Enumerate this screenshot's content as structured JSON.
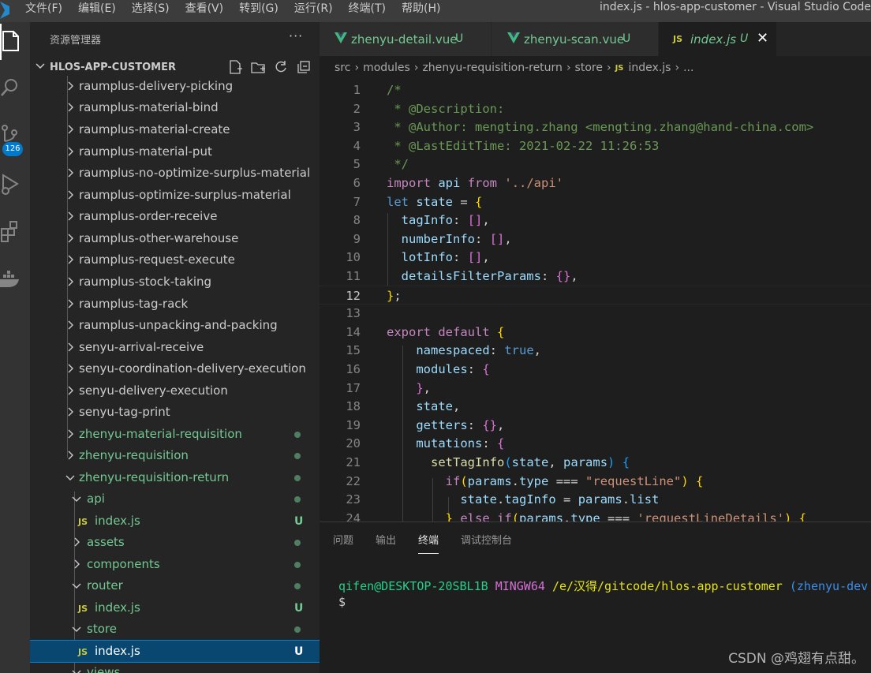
{
  "menu": [
    "文件(F)",
    "编辑(E)",
    "选择(S)",
    "查看(V)",
    "转到(G)",
    "运行(R)",
    "终端(T)",
    "帮助(H)"
  ],
  "window_title": "index.js - hlos-app-customer - Visual Studio Code",
  "activity": {
    "scm_badge": "126",
    "icons": [
      "explorer-icon",
      "search-icon",
      "source-control-icon",
      "run-debug-icon",
      "extensions-icon",
      "docker-icon"
    ]
  },
  "sidebar": {
    "title": "资源管理器",
    "more": "···",
    "project": "HLOS-APP-CUSTOMER",
    "items": [
      {
        "label": "raumplus-delivery-picking",
        "status": ""
      },
      {
        "label": "raumplus-material-bind",
        "status": ""
      },
      {
        "label": "raumplus-material-create",
        "status": ""
      },
      {
        "label": "raumplus-material-put",
        "status": ""
      },
      {
        "label": "raumplus-no-optimize-surplus-material",
        "status": ""
      },
      {
        "label": "raumplus-optimize-surplus-material",
        "status": ""
      },
      {
        "label": "raumplus-order-receive",
        "status": ""
      },
      {
        "label": "raumplus-other-warehouse",
        "status": ""
      },
      {
        "label": "raumplus-request-execute",
        "status": ""
      },
      {
        "label": "raumplus-stock-taking",
        "status": ""
      },
      {
        "label": "raumplus-tag-rack",
        "status": ""
      },
      {
        "label": "raumplus-unpacking-and-packing",
        "status": ""
      },
      {
        "label": "senyu-arrival-receive",
        "status": ""
      },
      {
        "label": "senyu-coordination-delivery-execution",
        "status": ""
      },
      {
        "label": "senyu-delivery-execution",
        "status": ""
      },
      {
        "label": "senyu-tag-print",
        "status": ""
      },
      {
        "label": "zhenyu-material-requisition",
        "status": ""
      },
      {
        "label": "zhenyu-requisition",
        "status": ""
      },
      {
        "label": "zhenyu-requisition-return",
        "status": ""
      },
      {
        "label": "api",
        "status": ""
      },
      {
        "label": "index.js",
        "status": "U"
      },
      {
        "label": "assets",
        "status": ""
      },
      {
        "label": "components",
        "status": ""
      },
      {
        "label": "router",
        "status": ""
      },
      {
        "label": "index.js",
        "status": "U"
      },
      {
        "label": "store",
        "status": ""
      },
      {
        "label": "index.js",
        "status": "U"
      },
      {
        "label": "views",
        "status": ""
      }
    ]
  },
  "tabs": [
    {
      "name": "zhenyu-detail.vue",
      "status": "U"
    },
    {
      "name": "zhenyu-scan.vue",
      "status": "U"
    },
    {
      "name": "index.js",
      "status": "U",
      "prefix": "JS",
      "close": "✕"
    }
  ],
  "breadcrumb": [
    "src",
    "modules",
    "zhenyu-requisition-return",
    "store",
    "JS",
    "index.js",
    "..."
  ],
  "editor": {
    "line_numbers": [
      "1",
      "2",
      "3",
      "4",
      "5",
      "6",
      "7",
      "8",
      "9",
      "10",
      "11",
      "12",
      "13",
      "14",
      "15",
      "16",
      "17",
      "18",
      "19",
      "20",
      "21",
      "22",
      "23",
      "24"
    ],
    "current_line": 12
  },
  "panel": {
    "tabs": [
      "问题",
      "输出",
      "终端",
      "调试控制台"
    ],
    "active_tab": "终端",
    "terminal": {
      "user": "qifen@DESKTOP-20SBL1B",
      "env": "MINGW64",
      "path": "/e/汉得/gitcode/hlos-app-customer",
      "branch": "(zhenyu-dev",
      "prompt": "$"
    }
  },
  "watermark": "CSDN @鸡翅有点甜。",
  "colors": {
    "accent": "#007acc",
    "untracked": "#73c991",
    "selection": "#094771"
  }
}
